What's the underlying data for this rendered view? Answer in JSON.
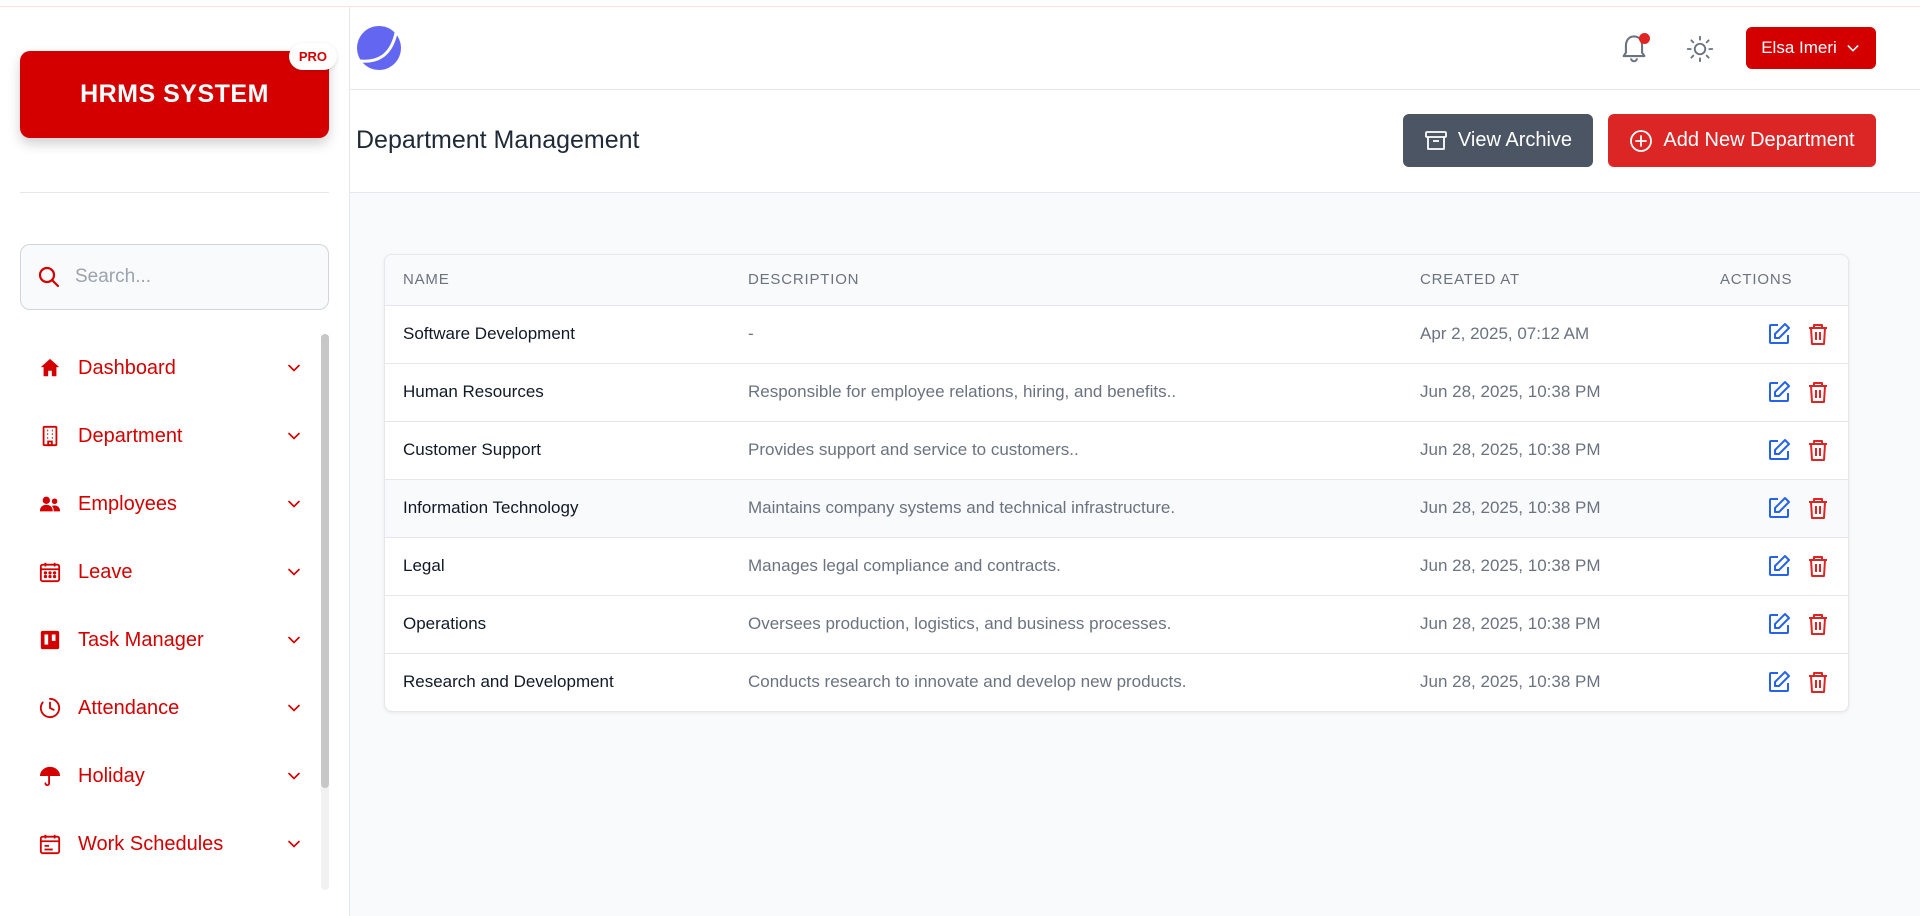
{
  "brand": {
    "title": "HRMS SYSTEM",
    "badge": "PRO"
  },
  "search": {
    "placeholder": "Search..."
  },
  "sidebar": {
    "items": [
      {
        "label": "Dashboard",
        "icon": "home-icon"
      },
      {
        "label": "Department",
        "icon": "building-icon"
      },
      {
        "label": "Employees",
        "icon": "users-icon"
      },
      {
        "label": "Leave",
        "icon": "calendar-icon"
      },
      {
        "label": "Task Manager",
        "icon": "kanban-icon"
      },
      {
        "label": "Attendance",
        "icon": "clock-icon"
      },
      {
        "label": "Holiday",
        "icon": "umbrella-icon"
      },
      {
        "label": "Work Schedules",
        "icon": "calendar-schedule-icon"
      }
    ]
  },
  "header": {
    "user_name": "Elsa Imeri"
  },
  "page": {
    "title": "Department Management",
    "archive_label": "View Archive",
    "add_label": "Add New Department"
  },
  "table": {
    "columns": [
      "NAME",
      "DESCRIPTION",
      "CREATED AT",
      "ACTIONS"
    ],
    "rows": [
      {
        "name": "Software Development",
        "description": "-",
        "created_at": "Apr 2, 2025, 07:12 AM"
      },
      {
        "name": "Human Resources",
        "description": "Responsible for employee relations, hiring, and benefits..",
        "created_at": "Jun 28, 2025, 10:38 PM"
      },
      {
        "name": "Customer Support",
        "description": "Provides support and service to customers..",
        "created_at": "Jun 28, 2025, 10:38 PM"
      },
      {
        "name": "Information Technology",
        "description": "Maintains company systems and technical infrastructure.",
        "created_at": "Jun 28, 2025, 10:38 PM"
      },
      {
        "name": "Legal",
        "description": "Manages legal compliance and contracts.",
        "created_at": "Jun 28, 2025, 10:38 PM"
      },
      {
        "name": "Operations",
        "description": "Oversees production, logistics, and business processes.",
        "created_at": "Jun 28, 2025, 10:38 PM"
      },
      {
        "name": "Research and Development",
        "description": "Conducts research to innovate and develop new products.",
        "created_at": "Jun 28, 2025, 10:38 PM"
      }
    ]
  },
  "colors": {
    "brand_red": "#d40000",
    "archive_gray": "#4b5563",
    "add_red": "#dc2626",
    "edit_blue": "#2563eb",
    "delete_red": "#dc2626",
    "logo_purple": "#6366f1"
  }
}
